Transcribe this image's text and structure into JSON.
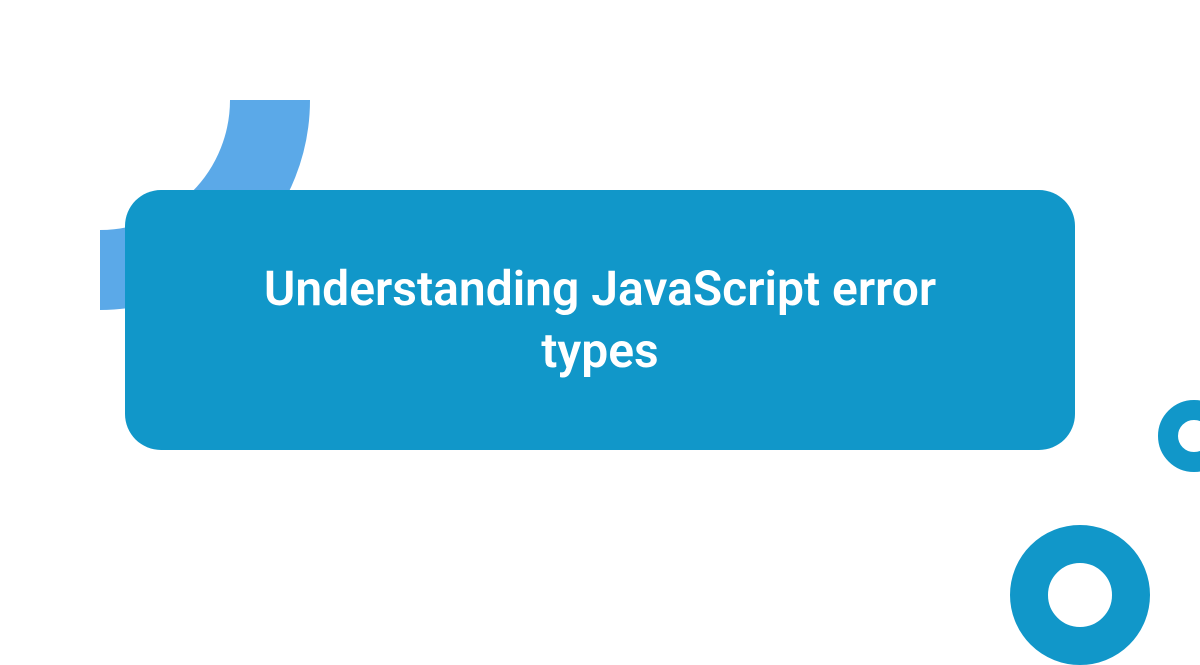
{
  "title": "Understanding JavaScript error types",
  "colors": {
    "primary": "#1197c9",
    "accent": "#5ba9e8",
    "background": "#ffffff",
    "text": "#ffffff"
  }
}
